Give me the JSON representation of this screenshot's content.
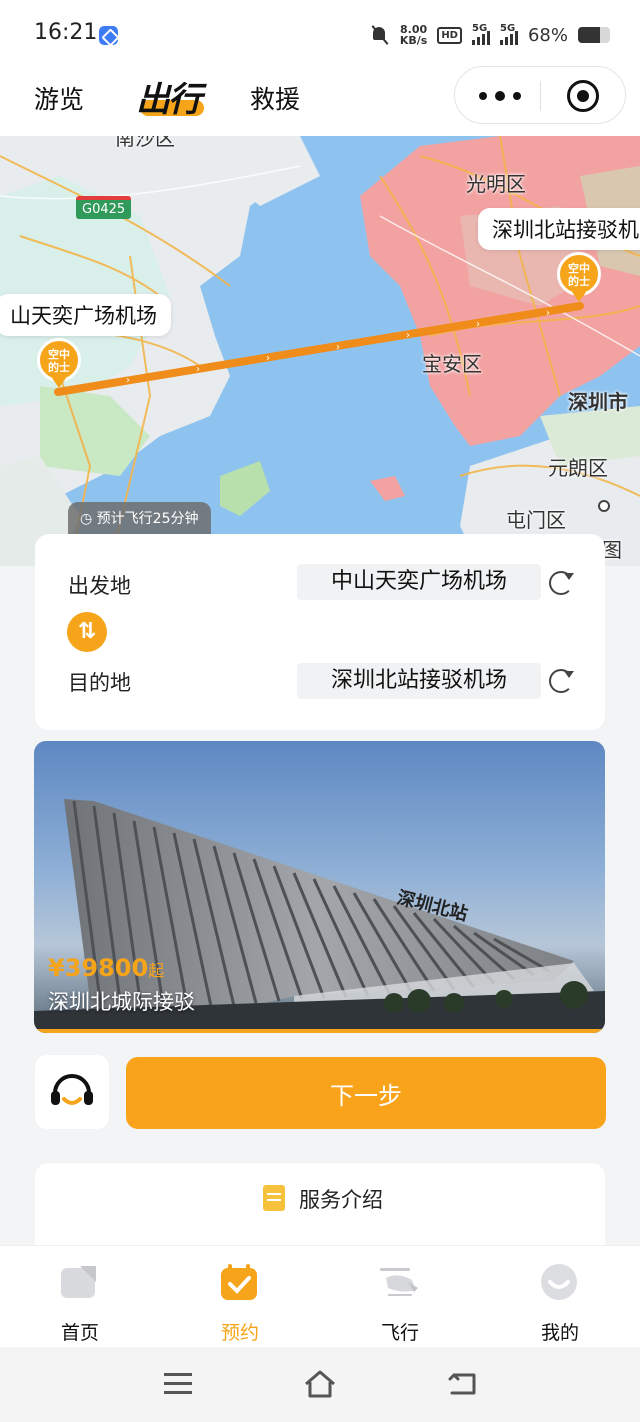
{
  "status": {
    "time": "16:21",
    "speed_value": "8.00",
    "speed_unit": "KB/s",
    "hd": "HD",
    "net1": "5G",
    "net2": "5G",
    "battery_text": "68%",
    "battery_level": 0.68
  },
  "header": {
    "nav": [
      "游览",
      "出行",
      "救援"
    ],
    "active_nav": "出行"
  },
  "map": {
    "labels": {
      "guangming": "光明区",
      "baoan": "宝安区",
      "yuanlang": "元朗区",
      "tunmen": "屯门区",
      "shenzhen_city": "深圳市",
      "nansha": "南沙区",
      "map_corner": "图"
    },
    "road_badge": "G0425",
    "origin_callout": "山天奕广场机场",
    "dest_callout": "深圳北站接驳机",
    "pin_text": "空中 的士",
    "flight_time": "预计飞行25分钟"
  },
  "route": {
    "from_label": "出发地",
    "from_value": "中山天奕广场机场",
    "to_label": "目的地",
    "to_value": "深圳北站接驳机场",
    "swap_symbol": "⇅"
  },
  "banner": {
    "price": "¥39800",
    "price_unit": "起",
    "name": "深圳北城际接驳",
    "sign": "深圳北站"
  },
  "actions": {
    "next_label": "下一步"
  },
  "service": {
    "title": "服务介绍"
  },
  "tabs": [
    {
      "label": "首页",
      "icon": "home-icon"
    },
    {
      "label": "预约",
      "icon": "booking-icon"
    },
    {
      "label": "飞行",
      "icon": "helicopter-icon"
    },
    {
      "label": "我的",
      "icon": "profile-icon"
    }
  ],
  "active_tab": "预约",
  "colors": {
    "accent": "#f6a41a",
    "urban_area": "#f3a2a2",
    "water": "#8fc3ef"
  }
}
